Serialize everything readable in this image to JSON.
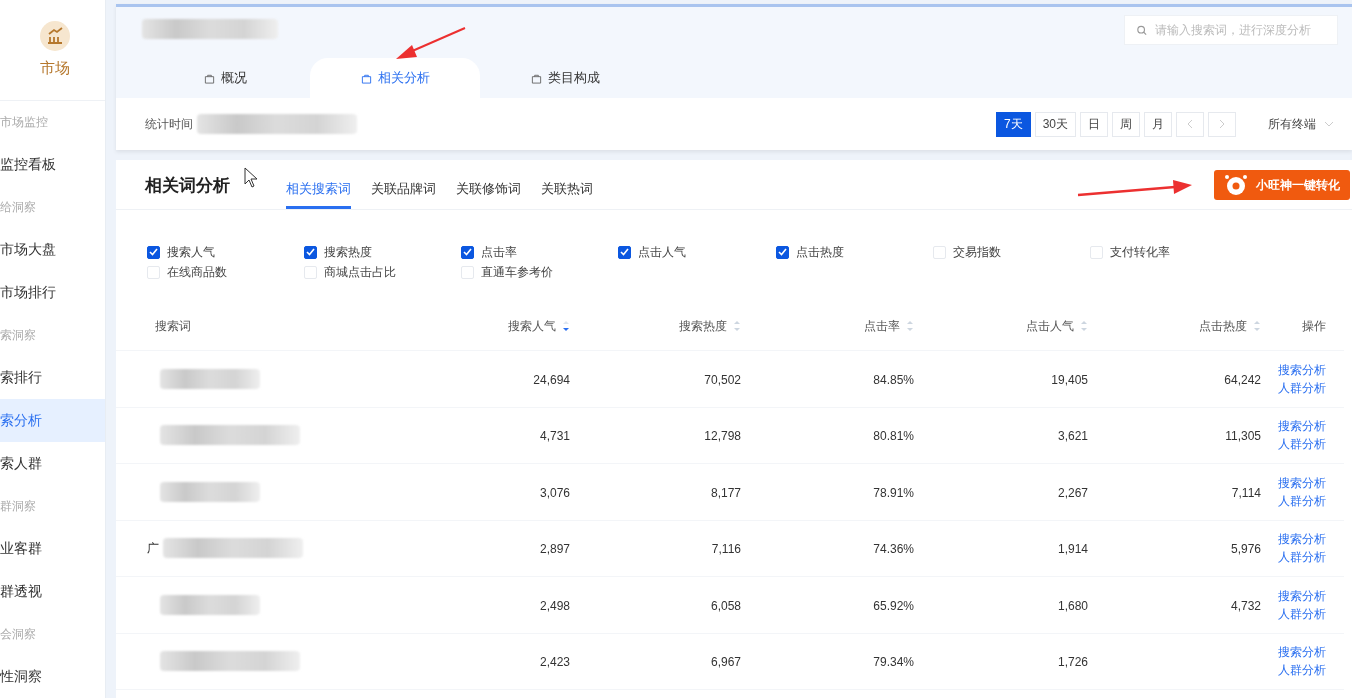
{
  "sidebar": {
    "module": "市场",
    "items": [
      {
        "kind": "header",
        "label": "市场监控"
      },
      {
        "kind": "item",
        "label": "监控看板",
        "selected": false
      },
      {
        "kind": "header",
        "label": "给洞察"
      },
      {
        "kind": "item",
        "label": "市场大盘",
        "selected": false
      },
      {
        "kind": "item",
        "label": "市场排行",
        "selected": false
      },
      {
        "kind": "header",
        "label": "索洞察"
      },
      {
        "kind": "item",
        "label": "索排行",
        "selected": false
      },
      {
        "kind": "item",
        "label": "索分析",
        "selected": true
      },
      {
        "kind": "item",
        "label": "索人群",
        "selected": false
      },
      {
        "kind": "header",
        "label": "群洞察"
      },
      {
        "kind": "item",
        "label": "业客群",
        "selected": false
      },
      {
        "kind": "item",
        "label": "群透视",
        "selected": false
      },
      {
        "kind": "header",
        "label": "会洞察"
      },
      {
        "kind": "item",
        "label": "性洞察",
        "selected": false
      }
    ]
  },
  "overview": {
    "search": {
      "placeholder": "请输入搜索词，进行深度分析"
    },
    "tabs": [
      {
        "label": "概况",
        "selected": false
      },
      {
        "label": "相关分析",
        "selected": true
      },
      {
        "label": "类目构成",
        "selected": false
      }
    ],
    "stat_label": "统计时间",
    "periods": [
      {
        "label": "7天",
        "selected": true
      },
      {
        "label": "30天",
        "selected": false
      },
      {
        "label": "日",
        "selected": false
      },
      {
        "label": "周",
        "selected": false
      },
      {
        "label": "月",
        "selected": false
      }
    ],
    "terminal": "所有终端"
  },
  "analysis": {
    "title": "相关词分析",
    "tabs": [
      {
        "label": "相关搜索词",
        "selected": true
      },
      {
        "label": "关联品牌词",
        "selected": false
      },
      {
        "label": "关联修饰词",
        "selected": false
      },
      {
        "label": "关联热词",
        "selected": false
      }
    ],
    "convert_button": "小旺神一键转化",
    "metrics": [
      {
        "label": "搜索人气",
        "checked": true
      },
      {
        "label": "搜索热度",
        "checked": true
      },
      {
        "label": "点击率",
        "checked": true
      },
      {
        "label": "点击人气",
        "checked": true
      },
      {
        "label": "点击热度",
        "checked": true
      },
      {
        "label": "交易指数",
        "checked": false
      },
      {
        "label": "支付转化率",
        "checked": false
      },
      {
        "label": "在线商品数",
        "checked": false
      },
      {
        "label": "商城点击占比",
        "checked": false
      },
      {
        "label": "直通车参考价",
        "checked": false
      }
    ],
    "table": {
      "columns": [
        {
          "label": "搜索词"
        },
        {
          "label": "搜索人气",
          "sorted": true
        },
        {
          "label": "搜索热度",
          "sorted": false
        },
        {
          "label": "点击率",
          "sorted": false
        },
        {
          "label": "点击人气",
          "sorted": false
        },
        {
          "label": "点击热度",
          "sorted": false
        },
        {
          "label": "操作"
        }
      ],
      "rows": [
        {
          "values": [
            "24,694",
            "70,502",
            "84.85%",
            "19,405",
            "64,242"
          ],
          "actions": [
            "搜索分析",
            "人群分析"
          ]
        },
        {
          "values": [
            "4,731",
            "12,798",
            "80.81%",
            "3,621",
            "11,305"
          ],
          "actions": [
            "搜索分析",
            "人群分析"
          ]
        },
        {
          "values": [
            "3,076",
            "8,177",
            "78.91%",
            "2,267",
            "7,114"
          ],
          "actions": [
            "搜索分析",
            "人群分析"
          ]
        },
        {
          "keyword": "广",
          "values": [
            "2,897",
            "7,116",
            "74.36%",
            "1,914",
            "5,976"
          ],
          "actions": [
            "搜索分析",
            "人群分析"
          ]
        },
        {
          "values": [
            "2,498",
            "6,058",
            "65.92%",
            "1,680",
            "4,732"
          ],
          "actions": [
            "搜索分析",
            "人群分析"
          ]
        },
        {
          "values": [
            "2,423",
            "6,967",
            "79.34%",
            "1,726"
          ],
          "actions": [
            "搜索分析",
            "人群分析"
          ]
        }
      ]
    }
  }
}
